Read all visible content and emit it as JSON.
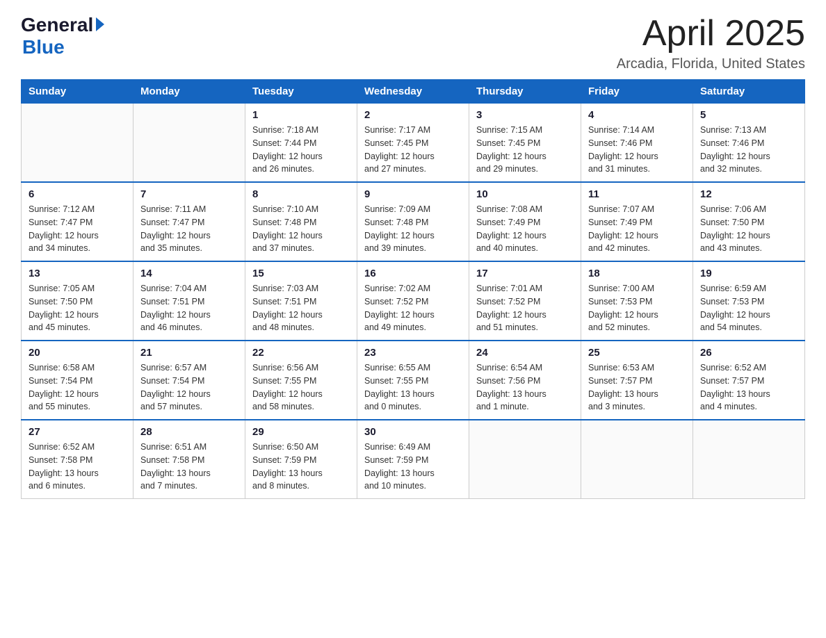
{
  "header": {
    "logo_general": "General",
    "logo_blue": "Blue",
    "month": "April 2025",
    "location": "Arcadia, Florida, United States"
  },
  "days_of_week": [
    "Sunday",
    "Monday",
    "Tuesday",
    "Wednesday",
    "Thursday",
    "Friday",
    "Saturday"
  ],
  "weeks": [
    [
      {
        "day": "",
        "info": ""
      },
      {
        "day": "",
        "info": ""
      },
      {
        "day": "1",
        "info": "Sunrise: 7:18 AM\nSunset: 7:44 PM\nDaylight: 12 hours\nand 26 minutes."
      },
      {
        "day": "2",
        "info": "Sunrise: 7:17 AM\nSunset: 7:45 PM\nDaylight: 12 hours\nand 27 minutes."
      },
      {
        "day": "3",
        "info": "Sunrise: 7:15 AM\nSunset: 7:45 PM\nDaylight: 12 hours\nand 29 minutes."
      },
      {
        "day": "4",
        "info": "Sunrise: 7:14 AM\nSunset: 7:46 PM\nDaylight: 12 hours\nand 31 minutes."
      },
      {
        "day": "5",
        "info": "Sunrise: 7:13 AM\nSunset: 7:46 PM\nDaylight: 12 hours\nand 32 minutes."
      }
    ],
    [
      {
        "day": "6",
        "info": "Sunrise: 7:12 AM\nSunset: 7:47 PM\nDaylight: 12 hours\nand 34 minutes."
      },
      {
        "day": "7",
        "info": "Sunrise: 7:11 AM\nSunset: 7:47 PM\nDaylight: 12 hours\nand 35 minutes."
      },
      {
        "day": "8",
        "info": "Sunrise: 7:10 AM\nSunset: 7:48 PM\nDaylight: 12 hours\nand 37 minutes."
      },
      {
        "day": "9",
        "info": "Sunrise: 7:09 AM\nSunset: 7:48 PM\nDaylight: 12 hours\nand 39 minutes."
      },
      {
        "day": "10",
        "info": "Sunrise: 7:08 AM\nSunset: 7:49 PM\nDaylight: 12 hours\nand 40 minutes."
      },
      {
        "day": "11",
        "info": "Sunrise: 7:07 AM\nSunset: 7:49 PM\nDaylight: 12 hours\nand 42 minutes."
      },
      {
        "day": "12",
        "info": "Sunrise: 7:06 AM\nSunset: 7:50 PM\nDaylight: 12 hours\nand 43 minutes."
      }
    ],
    [
      {
        "day": "13",
        "info": "Sunrise: 7:05 AM\nSunset: 7:50 PM\nDaylight: 12 hours\nand 45 minutes."
      },
      {
        "day": "14",
        "info": "Sunrise: 7:04 AM\nSunset: 7:51 PM\nDaylight: 12 hours\nand 46 minutes."
      },
      {
        "day": "15",
        "info": "Sunrise: 7:03 AM\nSunset: 7:51 PM\nDaylight: 12 hours\nand 48 minutes."
      },
      {
        "day": "16",
        "info": "Sunrise: 7:02 AM\nSunset: 7:52 PM\nDaylight: 12 hours\nand 49 minutes."
      },
      {
        "day": "17",
        "info": "Sunrise: 7:01 AM\nSunset: 7:52 PM\nDaylight: 12 hours\nand 51 minutes."
      },
      {
        "day": "18",
        "info": "Sunrise: 7:00 AM\nSunset: 7:53 PM\nDaylight: 12 hours\nand 52 minutes."
      },
      {
        "day": "19",
        "info": "Sunrise: 6:59 AM\nSunset: 7:53 PM\nDaylight: 12 hours\nand 54 minutes."
      }
    ],
    [
      {
        "day": "20",
        "info": "Sunrise: 6:58 AM\nSunset: 7:54 PM\nDaylight: 12 hours\nand 55 minutes."
      },
      {
        "day": "21",
        "info": "Sunrise: 6:57 AM\nSunset: 7:54 PM\nDaylight: 12 hours\nand 57 minutes."
      },
      {
        "day": "22",
        "info": "Sunrise: 6:56 AM\nSunset: 7:55 PM\nDaylight: 12 hours\nand 58 minutes."
      },
      {
        "day": "23",
        "info": "Sunrise: 6:55 AM\nSunset: 7:55 PM\nDaylight: 13 hours\nand 0 minutes."
      },
      {
        "day": "24",
        "info": "Sunrise: 6:54 AM\nSunset: 7:56 PM\nDaylight: 13 hours\nand 1 minute."
      },
      {
        "day": "25",
        "info": "Sunrise: 6:53 AM\nSunset: 7:57 PM\nDaylight: 13 hours\nand 3 minutes."
      },
      {
        "day": "26",
        "info": "Sunrise: 6:52 AM\nSunset: 7:57 PM\nDaylight: 13 hours\nand 4 minutes."
      }
    ],
    [
      {
        "day": "27",
        "info": "Sunrise: 6:52 AM\nSunset: 7:58 PM\nDaylight: 13 hours\nand 6 minutes."
      },
      {
        "day": "28",
        "info": "Sunrise: 6:51 AM\nSunset: 7:58 PM\nDaylight: 13 hours\nand 7 minutes."
      },
      {
        "day": "29",
        "info": "Sunrise: 6:50 AM\nSunset: 7:59 PM\nDaylight: 13 hours\nand 8 minutes."
      },
      {
        "day": "30",
        "info": "Sunrise: 6:49 AM\nSunset: 7:59 PM\nDaylight: 13 hours\nand 10 minutes."
      },
      {
        "day": "",
        "info": ""
      },
      {
        "day": "",
        "info": ""
      },
      {
        "day": "",
        "info": ""
      }
    ]
  ]
}
